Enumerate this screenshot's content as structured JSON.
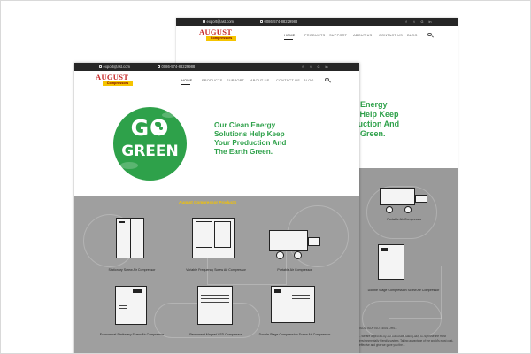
{
  "site": {
    "email": "export@ast.com",
    "phone": "0086-574-88229988",
    "logo_top": "AUGUST",
    "logo_bottom": "Compressors",
    "nav": [
      "HOME",
      "PRODUCTS",
      "SUPPORT",
      "ABOUT US",
      "CONTACT US",
      "BLOG"
    ],
    "social": [
      "f",
      "t",
      "G",
      "in"
    ]
  },
  "hero": {
    "badge_go": "GO",
    "badge_green": "GREEN",
    "tagline_lines": [
      "Our Clean Energy",
      "Solutions Help Keep",
      "Your Production And",
      "The Earth Green."
    ],
    "back_tagline_lines": [
      "n Energy",
      "s Help Keep",
      "duction And",
      "n Green."
    ]
  },
  "products": {
    "section_title": "August Compressor Products",
    "row1": [
      "Stationary Screw Air Compressor",
      "Variable Frequency Screw Air Compressor",
      "Portable Air Compressor"
    ],
    "row2": [
      "Economical Stationary Screw Air Compressor",
      "Permanent Magnet VSD Compressor",
      "Double Stage Compression Screw Air Compressor"
    ],
    "right_col": [
      "Portable Air Compressor",
      "Double Stage Compression Screw Air Compressor"
    ],
    "back_para_1": "ISO1, ISO9 ISO 14001 OHS...",
    "back_para_2": "...we are approved by our corporate, taking daily to high use the most environmentally friendly system. Taking advantage of the world's most cost-effective and give we gave you the..."
  },
  "colors": {
    "green": "#2ea14a",
    "topbar": "#262626",
    "gold": "#f5c400",
    "red": "#c62828",
    "gray_bg": "#9f9f9f"
  }
}
